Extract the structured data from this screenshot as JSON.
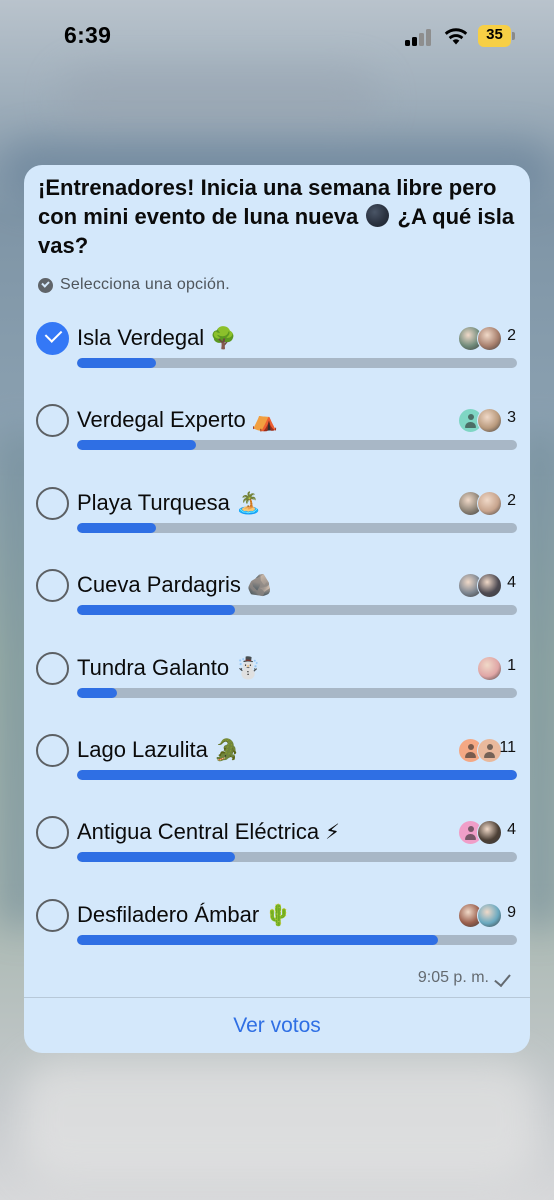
{
  "status_bar": {
    "time": "6:39",
    "battery": "35",
    "signal_icon": "cellular-signal-icon",
    "wifi_icon": "wifi-icon"
  },
  "poll": {
    "question_part1": "¡Entrenadores! Inicia una semana libre pero con mini evento de luna nueva",
    "question_part2": "¿A qué isla vas?",
    "question_icon": "new-moon-icon",
    "hint": "Selecciona una opción.",
    "accent_color": "#2f6fe4",
    "options": [
      {
        "label": "Isla Verdegal",
        "emoji": "🌳",
        "count": "2",
        "fraction": 0.18,
        "checked": true,
        "avatars": [
          {
            "kind": "photo",
            "color": "#6f8a7a"
          },
          {
            "kind": "photo",
            "color": "#a77f6d"
          }
        ]
      },
      {
        "label": "Verdegal Experto",
        "emoji": "⛺",
        "count": "3",
        "fraction": 0.27,
        "checked": false,
        "avatars": [
          {
            "kind": "person",
            "color": "#7fd6c4"
          },
          {
            "kind": "photo",
            "color": "#b99a7d"
          }
        ]
      },
      {
        "label": "Playa Turquesa",
        "emoji": "🏝️",
        "count": "2",
        "fraction": 0.18,
        "checked": false,
        "avatars": [
          {
            "kind": "photo",
            "color": "#8d8376"
          },
          {
            "kind": "photo",
            "color": "#c7a48d"
          }
        ]
      },
      {
        "label": "Cueva Pardagris",
        "emoji": "🪨",
        "count": "4",
        "fraction": 0.36,
        "checked": false,
        "avatars": [
          {
            "kind": "photo",
            "color": "#7c8590"
          },
          {
            "kind": "photo",
            "color": "#4d4a52"
          }
        ]
      },
      {
        "label": "Tundra Galanto",
        "emoji": "☃️",
        "count": "1",
        "fraction": 0.09,
        "checked": false,
        "avatars": [
          {
            "kind": "photo",
            "color": "#e0a6a6"
          }
        ]
      },
      {
        "label": "Lago Lazulita",
        "emoji": "🐊",
        "count": "11",
        "fraction": 1.0,
        "checked": false,
        "avatars": [
          {
            "kind": "person",
            "color": "#f4a884"
          },
          {
            "kind": "person",
            "color": "#e9b99c"
          }
        ]
      },
      {
        "label": "Antigua Central Eléctrica",
        "emoji": "⚡",
        "count": "4",
        "fraction": 0.36,
        "checked": false,
        "avatars": [
          {
            "kind": "person",
            "color": "#f09ec8"
          },
          {
            "kind": "photo",
            "color": "#4c4036"
          }
        ]
      },
      {
        "label": "Desfiladero Ámbar",
        "emoji": "🌵",
        "count": "9",
        "fraction": 0.82,
        "checked": false,
        "avatars": [
          {
            "kind": "photo",
            "color": "#9a5f4d"
          },
          {
            "kind": "photo",
            "color": "#6aa9c0"
          }
        ]
      }
    ],
    "timestamp": "9:05 p. m.",
    "read_icon": "checkmark-icon",
    "view_votes_label": "Ver votos"
  }
}
